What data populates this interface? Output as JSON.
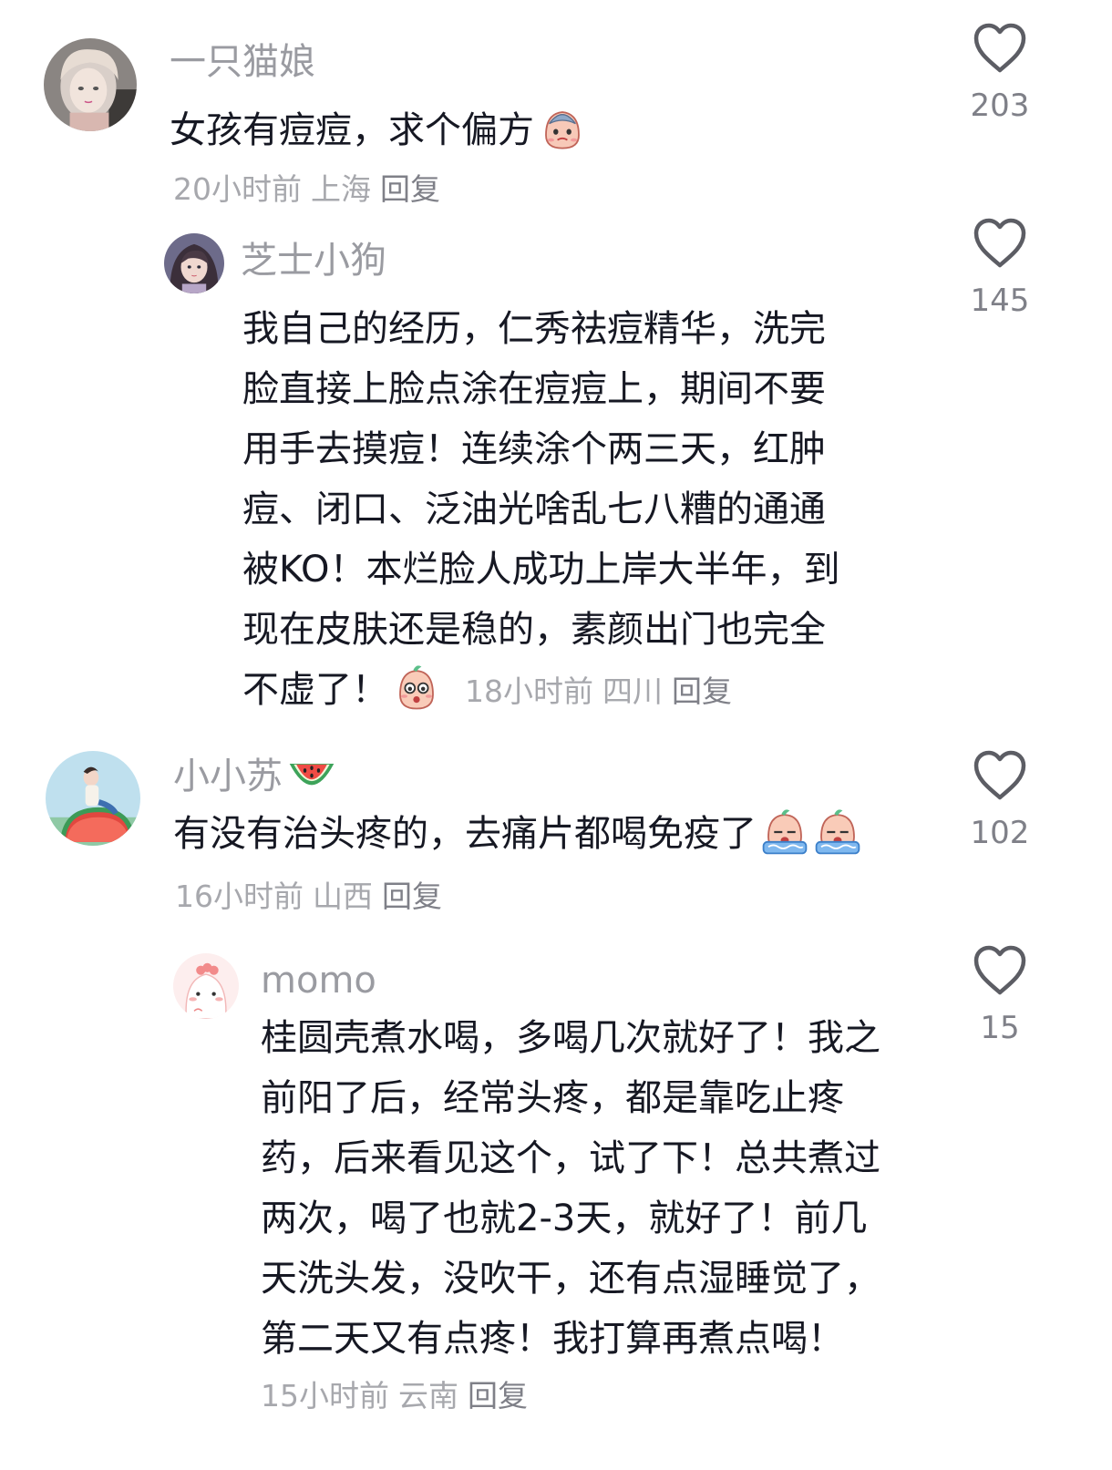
{
  "comments": [
    {
      "username": "一只猫娘",
      "text": "女孩有痘痘，求个偏方",
      "emoji": "crying-face-emoji",
      "time": "20小时前",
      "location": "上海",
      "reply": "回复",
      "likes": "203"
    },
    {
      "username": "芝士小狗",
      "lines": [
        "我自己的经历，仁秀祛痘精华，洗完",
        "脸直接上脸点涂在痘痘上，期间不要",
        "用手去摸痘！连续涂个两三天，红肿",
        "痘、闭口、泛油光啥乱七八糟的通通",
        "被KO！本烂脸人成功上岸大半年，到",
        "现在皮肤还是稳的，素颜出门也完全",
        "不虚了！"
      ],
      "emoji": "wow-face-emoji",
      "time": "18小时前",
      "location": "四川",
      "reply": "回复",
      "likes": "145"
    },
    {
      "username": "小小苏",
      "username_emoji": "watermelon-emoji",
      "text": "有没有治头疼的，去痛片都喝免疫了",
      "emoji": "sobbing-face-emoji",
      "time": "16小时前",
      "location": "山西",
      "reply": "回复",
      "likes": "102"
    },
    {
      "username": "momo",
      "lines": [
        "桂圆壳煮水喝，多喝几次就好了！我之",
        "前阳了后，经常头疼，都是靠吃止疼",
        "药，后来看见这个，试了下！总共煮过",
        "两次，喝了也就2-3天，就好了！前几",
        "天洗头发，没吹干，还有点湿睡觉了，",
        "第二天又有点疼！我打算再煮点喝！"
      ],
      "time": "15小时前",
      "location": "云南",
      "reply": "回复",
      "likes": "15"
    }
  ]
}
